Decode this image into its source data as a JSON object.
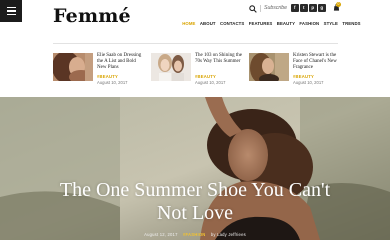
{
  "brand": {
    "logo": "Femmé"
  },
  "header": {
    "subscribe_label": "Subscribe",
    "socials": [
      "f",
      "t",
      "p",
      "g"
    ],
    "cart_count": "0",
    "accent_color": "#d9a400"
  },
  "nav": {
    "items": [
      {
        "label": "HOME",
        "active": true
      },
      {
        "label": "ABOUT",
        "active": false
      },
      {
        "label": "CONTACTS",
        "active": false
      },
      {
        "label": "FEATURES",
        "active": false
      },
      {
        "label": "BEAUTY",
        "active": false
      },
      {
        "label": "FASHION",
        "active": false
      },
      {
        "label": "STYLE",
        "active": false
      },
      {
        "label": "TRENDS",
        "active": false
      }
    ]
  },
  "featured": [
    {
      "title": "Elie Saab on Dressing the A List and Bold New Plans",
      "tag": "#BEAUTY",
      "date": "August 10, 2017"
    },
    {
      "title": "The 103 on Shining the 70s Way This Summer",
      "tag": "#BEAUTY",
      "date": "August 10, 2017"
    },
    {
      "title": "Kristen Stewart is the Face of Chanel's New Fragrance",
      "tag": "#BEAUTY",
      "date": "August 10, 2017"
    }
  ],
  "hero": {
    "title_line1": "The One Summer Shoe You Can't",
    "title_line2": "Not Love",
    "date": "August 12, 2017",
    "tag": "#FASHION",
    "author": "by Lady Jeffriees"
  }
}
